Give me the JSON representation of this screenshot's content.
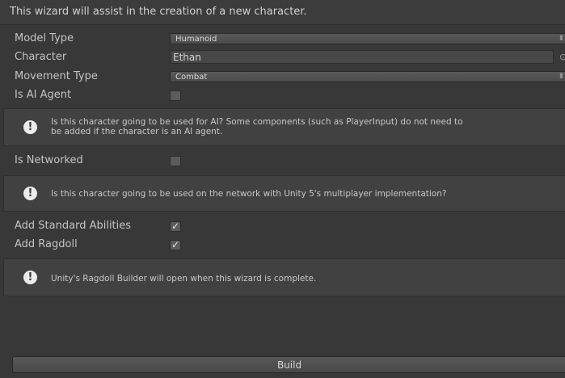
{
  "header": {
    "text": "This wizard will assist in the creation of a new character."
  },
  "fields": {
    "model_type": {
      "label": "Model Type",
      "value": "Humanoid"
    },
    "character": {
      "label": "Character",
      "value": "Ethan"
    },
    "movement_type": {
      "label": "Movement Type",
      "value": "Combat"
    },
    "is_ai_agent": {
      "label": "Is AI Agent",
      "checked": false
    },
    "is_networked": {
      "label": "Is Networked",
      "checked": false
    },
    "add_standard_abilities": {
      "label": "Add Standard Abilities",
      "checked": true
    },
    "add_ragdoll": {
      "label": "Add Ragdoll",
      "checked": true
    }
  },
  "help": {
    "ai_line1": "Is this character going to be used for AI? Some components (such as PlayerInput) do not need to",
    "ai_line2": "be added if the character is an AI agent.",
    "network": "Is this character going to be used on the network with Unity 5's multiplayer implementation?",
    "ragdoll": "Unity's Ragdoll Builder will open when this wizard is complete."
  },
  "glyphs": {
    "dropdown_arrow": "⬍",
    "checkmark": "✓",
    "info": "!",
    "picker": "⊙"
  },
  "build_button": {
    "label": "Build"
  },
  "icons": [
    "dropdown-arrow-icon",
    "object-picker-icon",
    "checkmark-icon",
    "info-icon"
  ]
}
